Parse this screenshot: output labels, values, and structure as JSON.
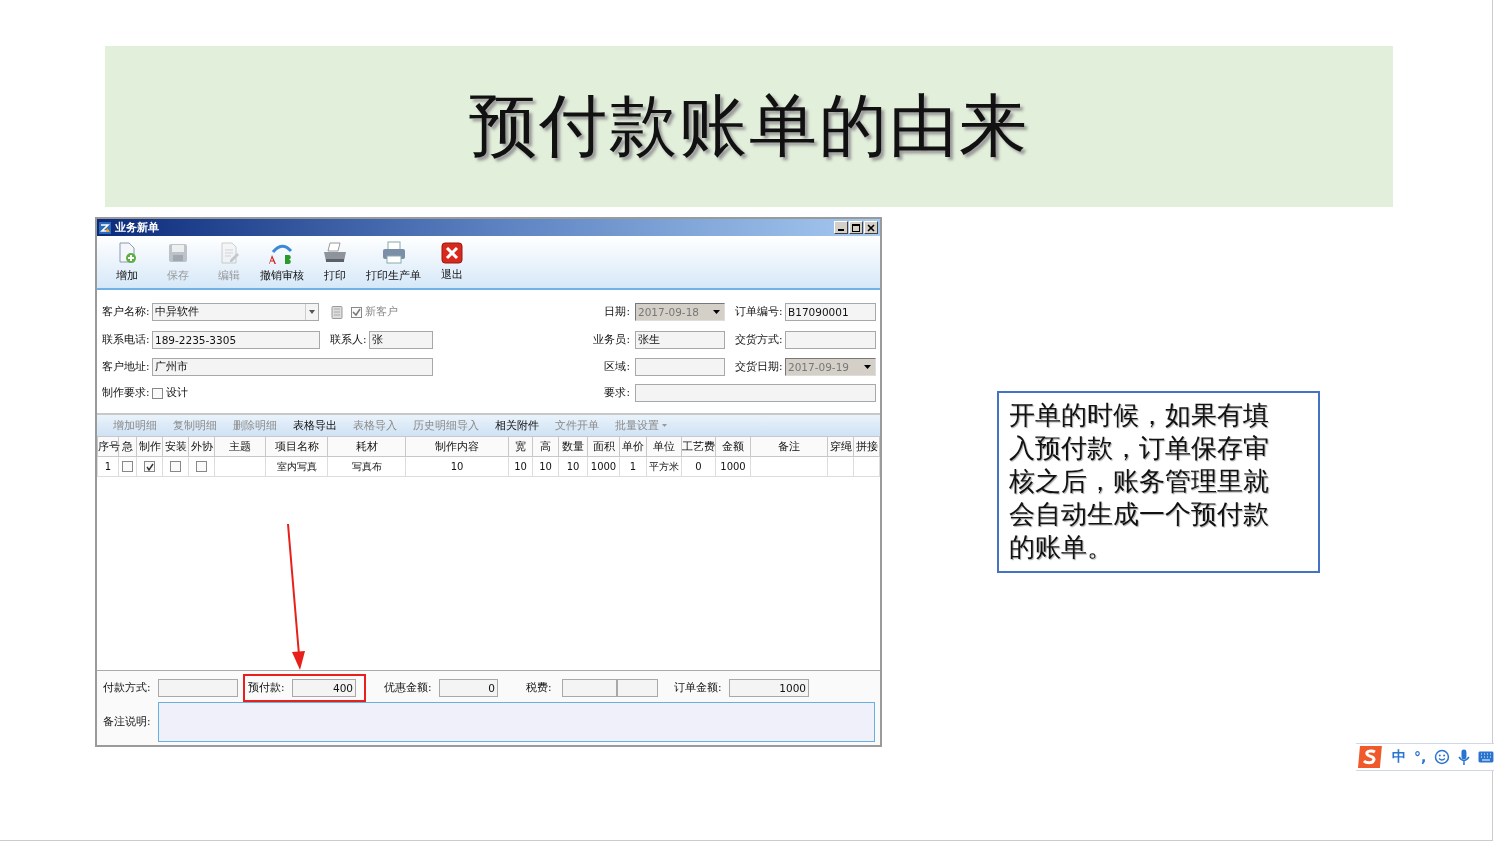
{
  "slide_title": "预付款账单的由来",
  "window": {
    "title": "业务新单"
  },
  "toolbar": [
    {
      "label": "增加",
      "disabled": false
    },
    {
      "label": "保存",
      "disabled": true
    },
    {
      "label": "编辑",
      "disabled": true
    },
    {
      "label": "撤销审核",
      "disabled": false
    },
    {
      "label": "打印",
      "disabled": false
    },
    {
      "label": "打印生产单",
      "disabled": false
    },
    {
      "label": "退出",
      "disabled": false
    }
  ],
  "form": {
    "customer_name": {
      "label": "客户名称:",
      "value": "中异软件"
    },
    "new_customer": {
      "label": "新客户",
      "checked": true
    },
    "date": {
      "label": "日期:",
      "value": "2017-09-18",
      "disabled": true
    },
    "order_no": {
      "label": "订单编号:",
      "value": "B17090001"
    },
    "phone": {
      "label": "联系电话:",
      "value": "189-2235-3305"
    },
    "contact": {
      "label": "联系人:",
      "value": "张"
    },
    "salesperson": {
      "label": "业务员:",
      "value": "张生"
    },
    "delivery_method": {
      "label": "交货方式:"
    },
    "address": {
      "label": "客户地址:",
      "value": "广州市"
    },
    "region": {
      "label": "区域:"
    },
    "delivery_date": {
      "label": "交货日期:",
      "value": "2017-09-19",
      "disabled": true
    },
    "production_label": "制作要求:",
    "design": {
      "label": "设计",
      "checked": false
    },
    "requirement": {
      "label": "要求:"
    }
  },
  "detail_toolbar": [
    {
      "label": "增加明细",
      "disabled": true
    },
    {
      "label": "复制明细",
      "disabled": true
    },
    {
      "label": "删除明细",
      "disabled": true
    },
    {
      "label": "表格导出",
      "disabled": false
    },
    {
      "label": "表格导入",
      "disabled": true
    },
    {
      "label": "历史明细导入",
      "disabled": true
    },
    {
      "label": "相关附件",
      "disabled": false
    },
    {
      "label": "文件开单",
      "disabled": true
    },
    {
      "label": "批量设置",
      "disabled": true,
      "kind": "dropdown"
    }
  ],
  "table": {
    "columns": [
      "序号",
      "急",
      "制作",
      "安装",
      "外协",
      "主题",
      "项目名称",
      "耗材",
      "制作内容",
      "宽",
      "高",
      "数量",
      "面积",
      "单价",
      "单位",
      "工艺费",
      "金额",
      "备注",
      "穿绳",
      "拼接"
    ],
    "rows": [
      {
        "cells": [
          "1",
          {
            "checked": false
          },
          {
            "checked": true
          },
          {
            "checked": false
          },
          {
            "checked": false
          },
          "",
          "室内写真",
          "写真布",
          "10",
          "10",
          "10",
          "10",
          "1000",
          "1",
          "平方米",
          "0",
          "1000",
          "",
          "",
          ""
        ]
      }
    ]
  },
  "footer": {
    "payment_method": {
      "label": "付款方式:"
    },
    "prepayment": {
      "label": "预付款:",
      "value": "400"
    },
    "discount": {
      "label": "优惠金额:",
      "value": "0"
    },
    "tax": {
      "label": "税费:"
    },
    "order_amount": {
      "label": "订单金额:",
      "value": "1000"
    },
    "remarks": {
      "label": "备注说明:"
    }
  },
  "note": "开单的时候，如果有填入预付款，订单保存审核之后，账务管理里就会自动生成一个预付款的账单。",
  "ime": {
    "mode": "中",
    "punctuation": "°,"
  }
}
